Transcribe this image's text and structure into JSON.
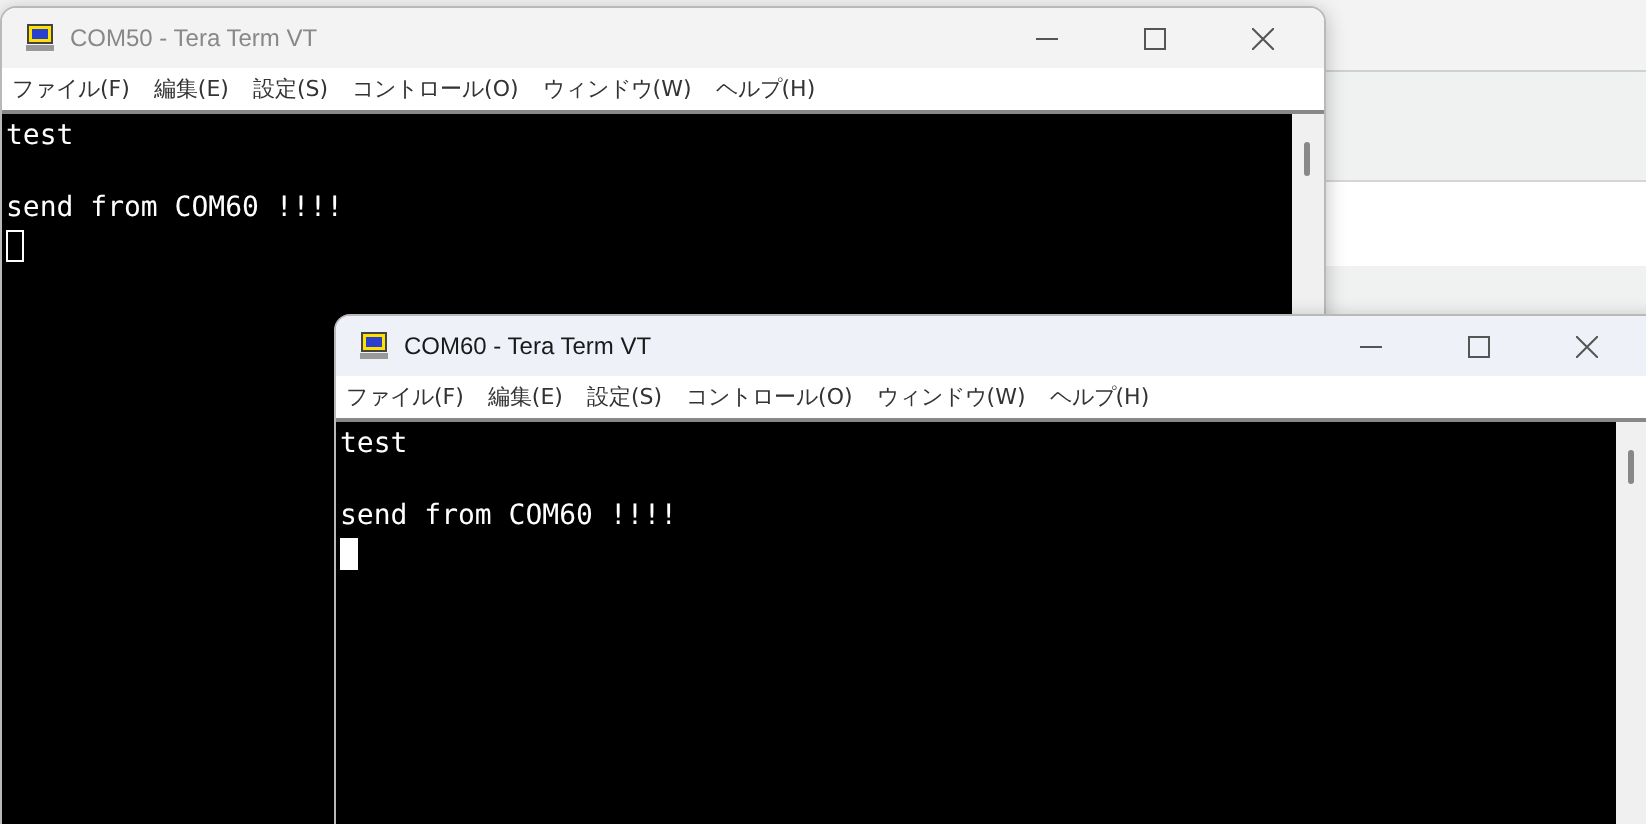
{
  "windows": [
    {
      "title": "COM50 - Tera Term VT",
      "active": false,
      "menu": [
        "ファイル(F)",
        "編集(E)",
        "設定(S)",
        "コントロール(O)",
        "ウィンドウ(W)",
        "ヘルプ(H)"
      ],
      "lines": [
        "test",
        "send from COM60 !!!!"
      ]
    },
    {
      "title": "COM60 - Tera Term VT",
      "active": true,
      "menu": [
        "ファイル(F)",
        "編集(E)",
        "設定(S)",
        "コントロール(O)",
        "ウィンドウ(W)",
        "ヘルプ(H)"
      ],
      "lines": [
        "test",
        "send from COM60 !!!!"
      ]
    }
  ]
}
